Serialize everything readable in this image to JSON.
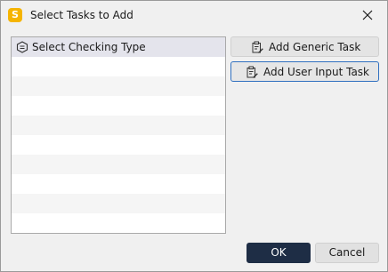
{
  "window": {
    "title": "Select Tasks to Add",
    "app_icon_letter": "S",
    "app_icon_color": "#f5b400",
    "close_icon": "close-icon"
  },
  "task_list": {
    "header_label": "Select Checking Type",
    "header_icon": "checklist-badge-icon"
  },
  "actions": {
    "add_generic_label": "Add Generic Task",
    "add_user_input_label": "Add User Input Task",
    "task_icon": "clipboard-edit-icon"
  },
  "footer": {
    "ok_label": "OK",
    "cancel_label": "Cancel"
  },
  "colors": {
    "accent_primary": "#1e2d45",
    "focus_border": "#3070c0",
    "list_header_bg": "#e4e4ec"
  }
}
